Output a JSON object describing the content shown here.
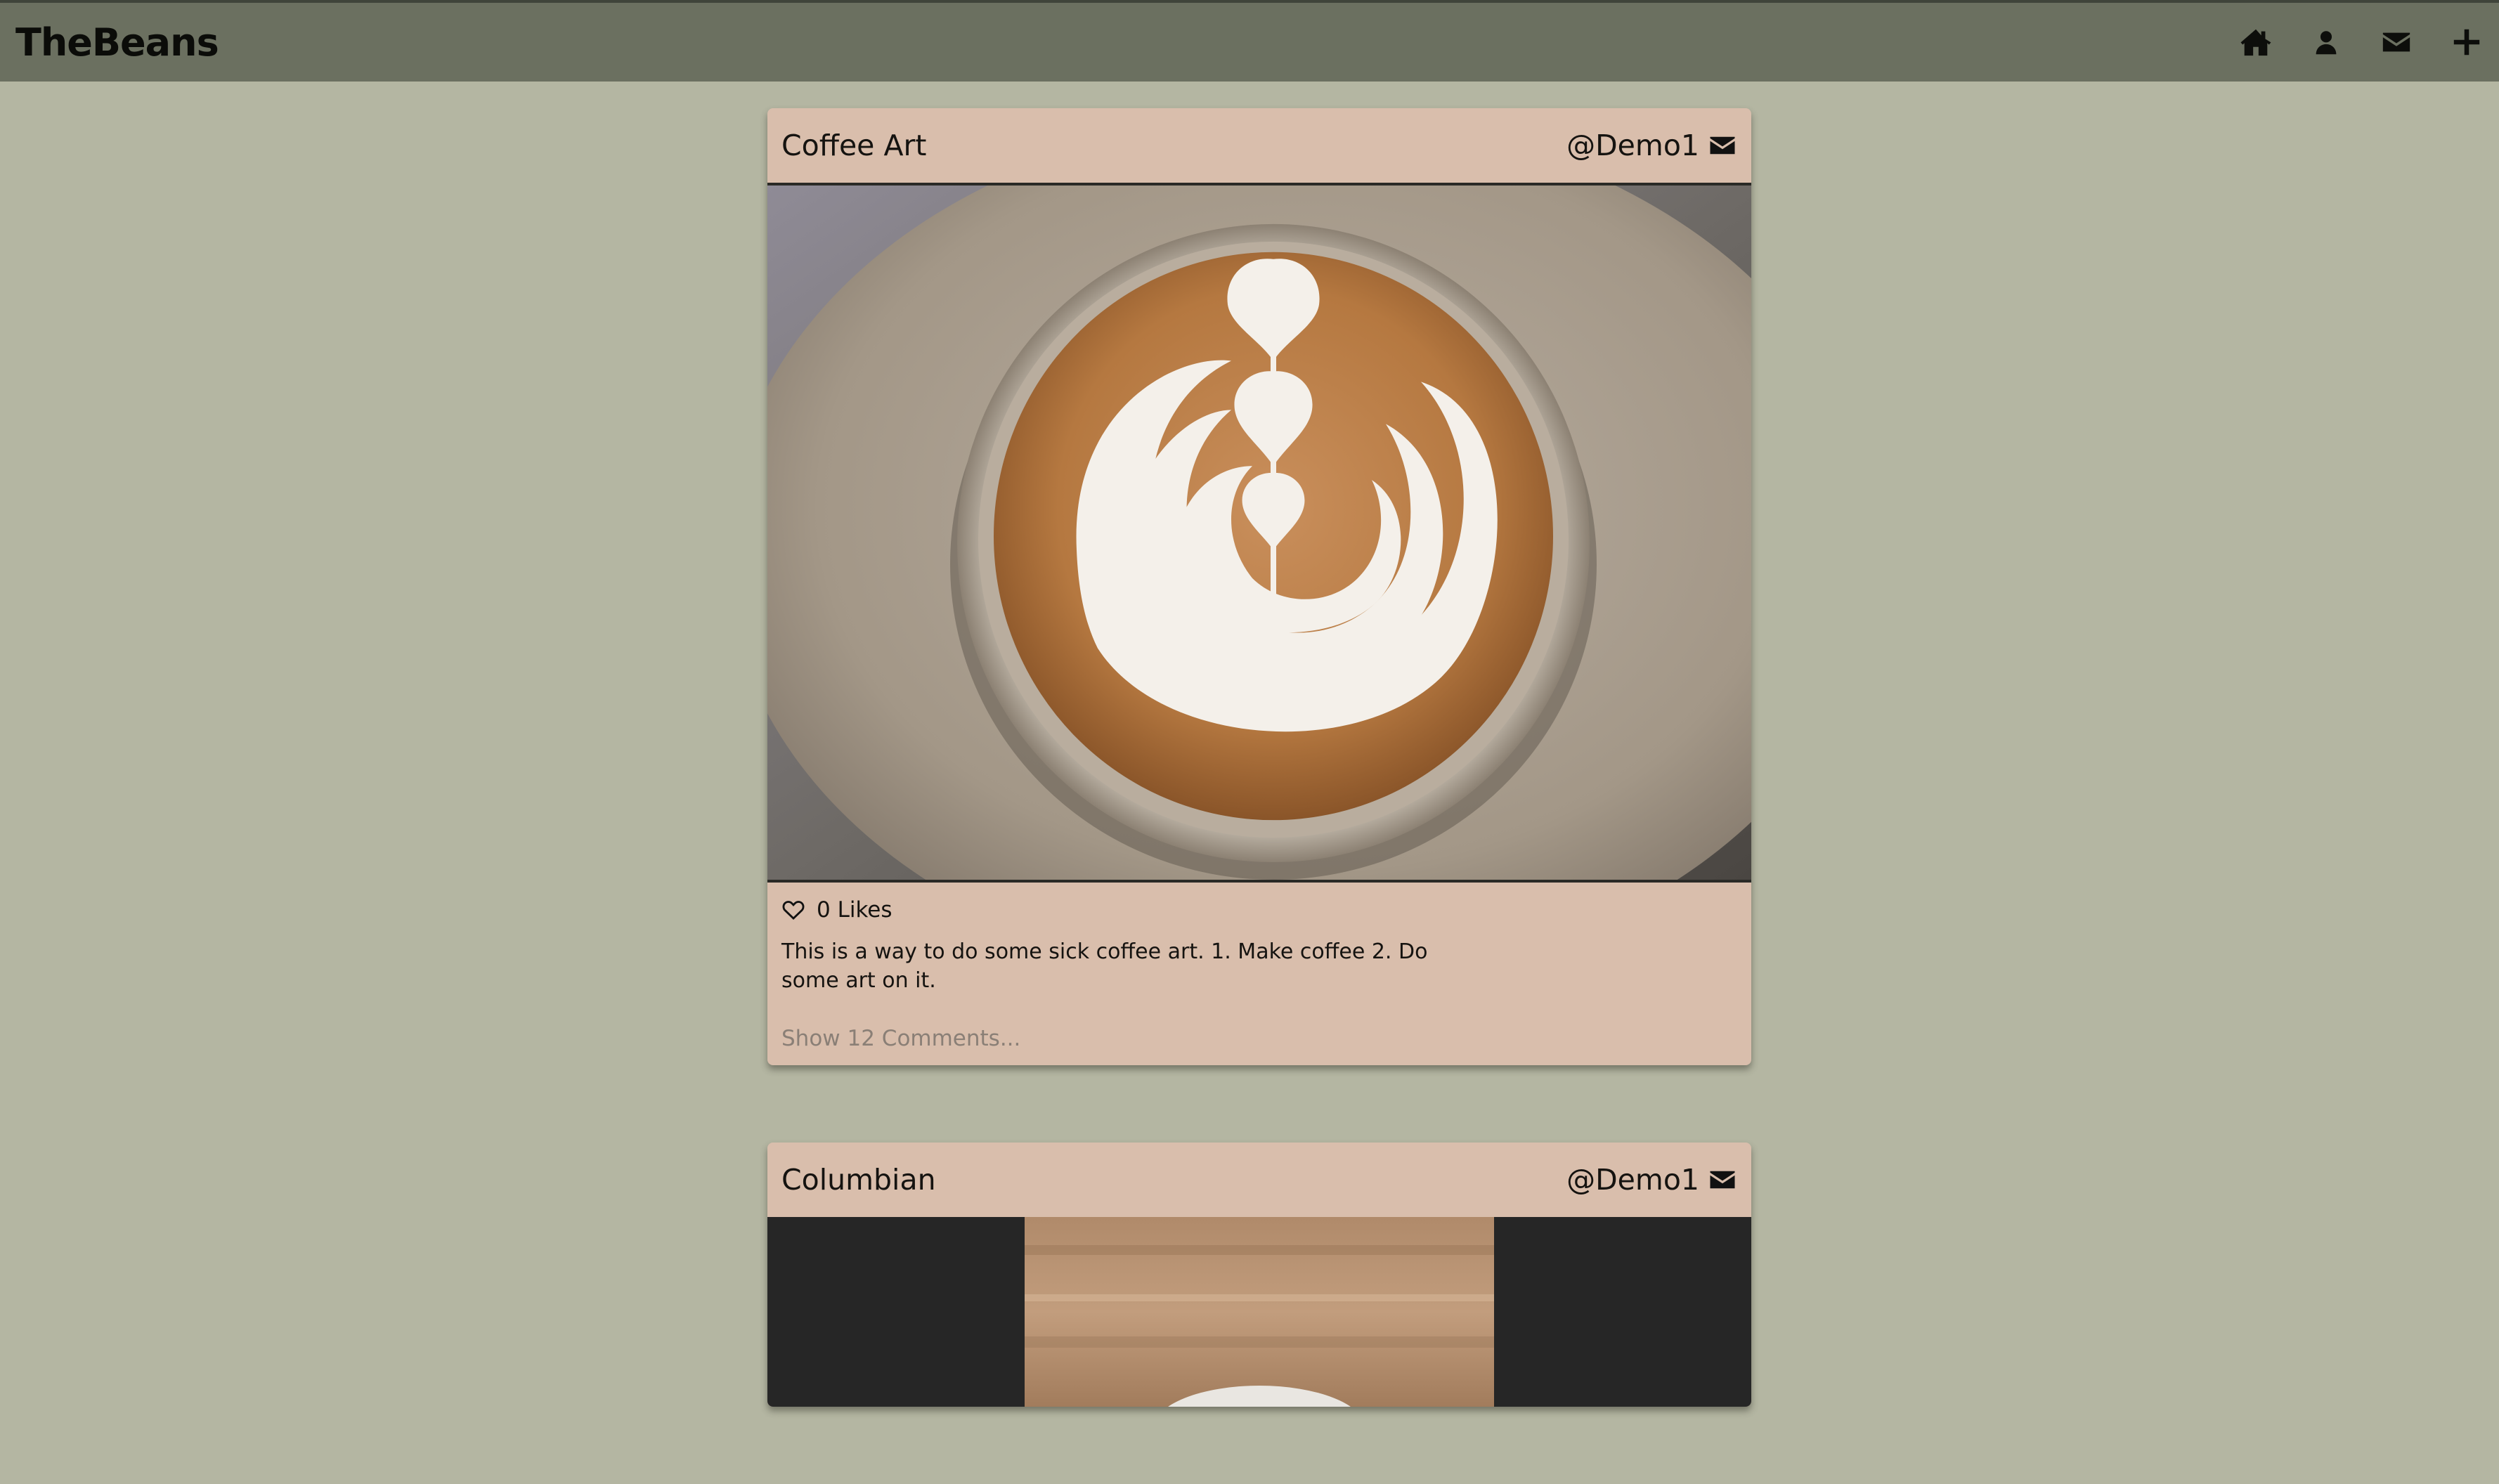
{
  "app": {
    "brand": "TheBeans"
  },
  "nav": {
    "items": [
      {
        "icon": "home-icon"
      },
      {
        "icon": "user-icon"
      },
      {
        "icon": "mail-icon"
      },
      {
        "icon": "plus-icon"
      }
    ]
  },
  "posts": [
    {
      "title": "Coffee Art",
      "author": "@Demo1",
      "likes": "0 Likes",
      "description": "This is a way to do some sick coffee art. 1. Make coffee 2. Do some art on it.",
      "comments_link": "Show 12 Comments..."
    },
    {
      "title": "Columbian",
      "author": "@Demo1"
    }
  ],
  "colors": {
    "background": "#b4b6a2",
    "topbar": "#6b7060",
    "card": "#d9beac",
    "muted_text": "#8a7f76"
  }
}
